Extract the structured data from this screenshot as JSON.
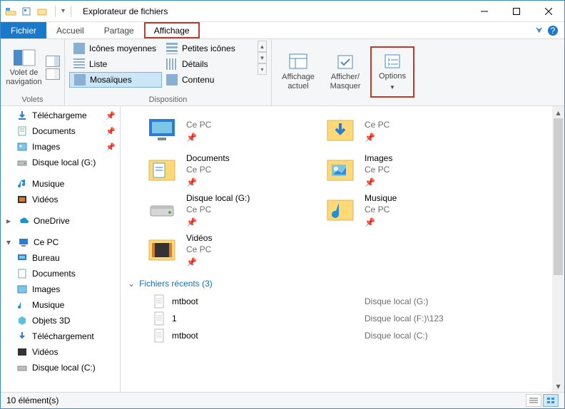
{
  "window": {
    "title": "Explorateur de fichiers"
  },
  "tabs": {
    "file": "Fichier",
    "home": "Accueil",
    "share": "Partage",
    "view": "Affichage"
  },
  "ribbon": {
    "panes_group": "Volets",
    "layout_group": "Disposition",
    "nav_pane": "Volet de\nnavigation",
    "layout": {
      "medium": "Icônes moyennes",
      "small": "Petites icônes",
      "list": "Liste",
      "details": "Détails",
      "tiles": "Mosaïques",
      "content": "Contenu"
    },
    "current_view": "Affichage\nactuel",
    "show_hide": "Afficher/\nMasquer",
    "options": "Options"
  },
  "sidebar": {
    "downloads": "Téléchargeme",
    "documents": "Documents",
    "images": "Images",
    "localg": "Disque local (G:)",
    "music": "Musique",
    "videos": "Vidéos",
    "onedrive": "OneDrive",
    "thispc": "Ce PC",
    "desktop": "Bureau",
    "documents2": "Documents",
    "images2": "Images",
    "music2": "Musique",
    "objects3d": "Objets 3D",
    "downloads2": "Téléchargement",
    "videos2": "Vidéos",
    "localc": "Disque local (C:)"
  },
  "tiles": [
    {
      "name": "",
      "sub": "Ce PC",
      "icon": "desktop"
    },
    {
      "name": "",
      "sub": "Ce PC",
      "icon": "downloads"
    },
    {
      "name": "Documents",
      "sub": "Ce PC",
      "icon": "documents"
    },
    {
      "name": "Images",
      "sub": "Ce PC",
      "icon": "images"
    },
    {
      "name": "Disque local (G:)",
      "sub": "Ce PC",
      "icon": "drive"
    },
    {
      "name": "Musique",
      "sub": "Ce PC",
      "icon": "music"
    },
    {
      "name": "Vidéos",
      "sub": "Ce PC",
      "icon": "videos"
    }
  ],
  "recent": {
    "header": "Fichiers récents (3)",
    "rows": [
      {
        "name": "mtboot",
        "loc": "Disque local (G:)"
      },
      {
        "name": "1",
        "loc": "Disque local (F:)\\123"
      },
      {
        "name": "mtboot",
        "loc": "Disque local (C:)"
      }
    ]
  },
  "status": {
    "count": "10 élément(s)"
  }
}
